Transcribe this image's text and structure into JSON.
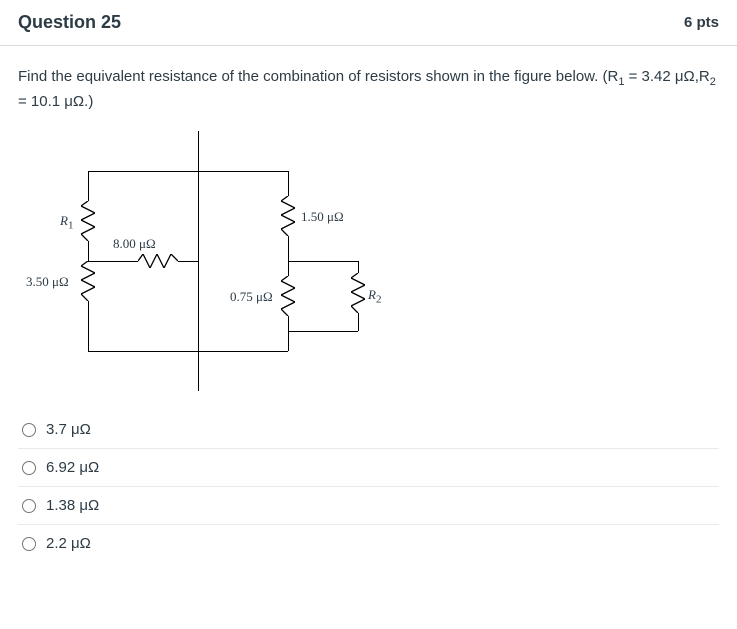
{
  "header": {
    "title": "Question 25",
    "points": "6 pts"
  },
  "prompt": {
    "text_before": "Find the equivalent resistance of the combination of resistors shown in the figure below. (R",
    "sub1": "1",
    "text_mid": " = 3.42 μΩ,R",
    "sub2": "2",
    "text_after": " = 10.1 μΩ.)"
  },
  "circuit": {
    "r1_label_sym": "R",
    "r1_label_sub": "1",
    "r2_label_sym": "R",
    "r2_label_sub": "2",
    "r_8": "8.00 μΩ",
    "r_350": "3.50 μΩ",
    "r_075": "0.75 μΩ",
    "r_150": "1.50 μΩ"
  },
  "options": [
    "3.7 μΩ",
    "6.92 μΩ",
    "1.38 μΩ",
    "2.2 μΩ"
  ]
}
